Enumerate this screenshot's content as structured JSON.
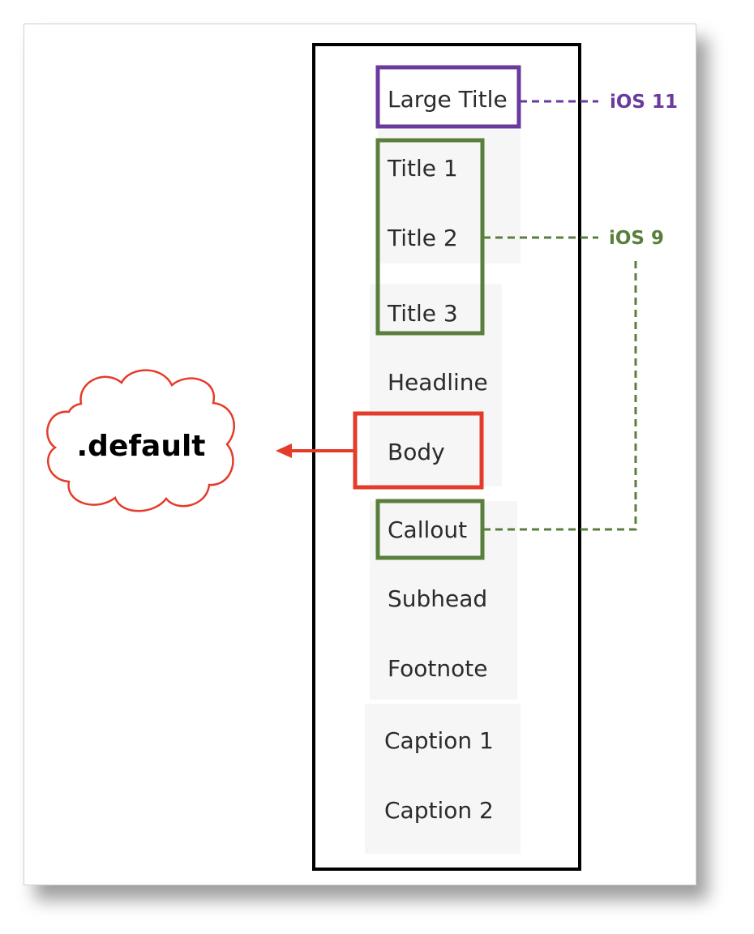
{
  "styles": [
    "Large Title",
    "Title 1",
    "Title 2",
    "Title 3",
    "Headline",
    "Body",
    "Callout",
    "Subhead",
    "Footnote",
    "Caption 1",
    "Caption 2"
  ],
  "annotations": {
    "ios11_label": "iOS 11",
    "ios9_label": "iOS 9",
    "default_label": ".default"
  },
  "colors": {
    "ios11": "#6a3a9c",
    "ios9": "#5a7f3c",
    "default": "#e43b2a",
    "frame": "#000000"
  }
}
